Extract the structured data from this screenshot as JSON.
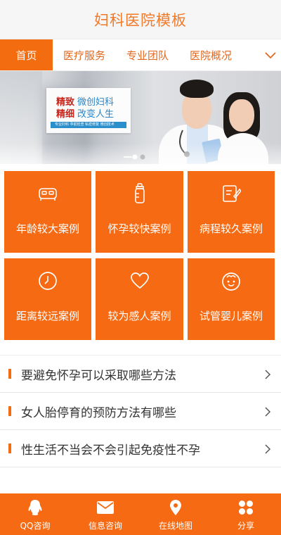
{
  "header": {
    "title": "妇科医院模板"
  },
  "nav": {
    "tabs": [
      "首页",
      "医疗服务",
      "专业团队",
      "医院概况"
    ],
    "active_tab": 0,
    "more_icon": "chevron-down-icon"
  },
  "banner": {
    "line1_red": "精致",
    "line1_blue": "微创妇科",
    "line2_red": "精细",
    "line2_blue": "改变人生",
    "strip_text": "专业妇科 孕前检查 私密修复 微创技术",
    "slide_count": 2,
    "active_slide": 0
  },
  "grid": [
    {
      "label": "年龄较大案例",
      "icon": "bed-icon"
    },
    {
      "label": "怀孕较快案例",
      "icon": "baby-bottle-icon"
    },
    {
      "label": "病程较久案例",
      "icon": "edit-note-icon"
    },
    {
      "label": "距离较远案例",
      "icon": "clock-icon"
    },
    {
      "label": "较为感人案例",
      "icon": "heart-icon"
    },
    {
      "label": "试管婴儿案例",
      "icon": "baby-face-icon"
    }
  ],
  "articles": [
    {
      "title": "要避免怀孕可以采取哪些方法"
    },
    {
      "title": "女人胎停育的预防方法有哪些"
    },
    {
      "title": "性生活不当会不会引起免疫性不孕"
    }
  ],
  "footer": [
    {
      "label": "QQ咨询",
      "icon": "qq-icon"
    },
    {
      "label": "信息咨询",
      "icon": "envelope-icon"
    },
    {
      "label": "在线地图",
      "icon": "map-pin-icon"
    },
    {
      "label": "分享",
      "icon": "share-grid-icon"
    }
  ],
  "colors": {
    "accent": "#f56a12",
    "title": "#f07a2a",
    "header_bg": "#f6f6f6"
  }
}
